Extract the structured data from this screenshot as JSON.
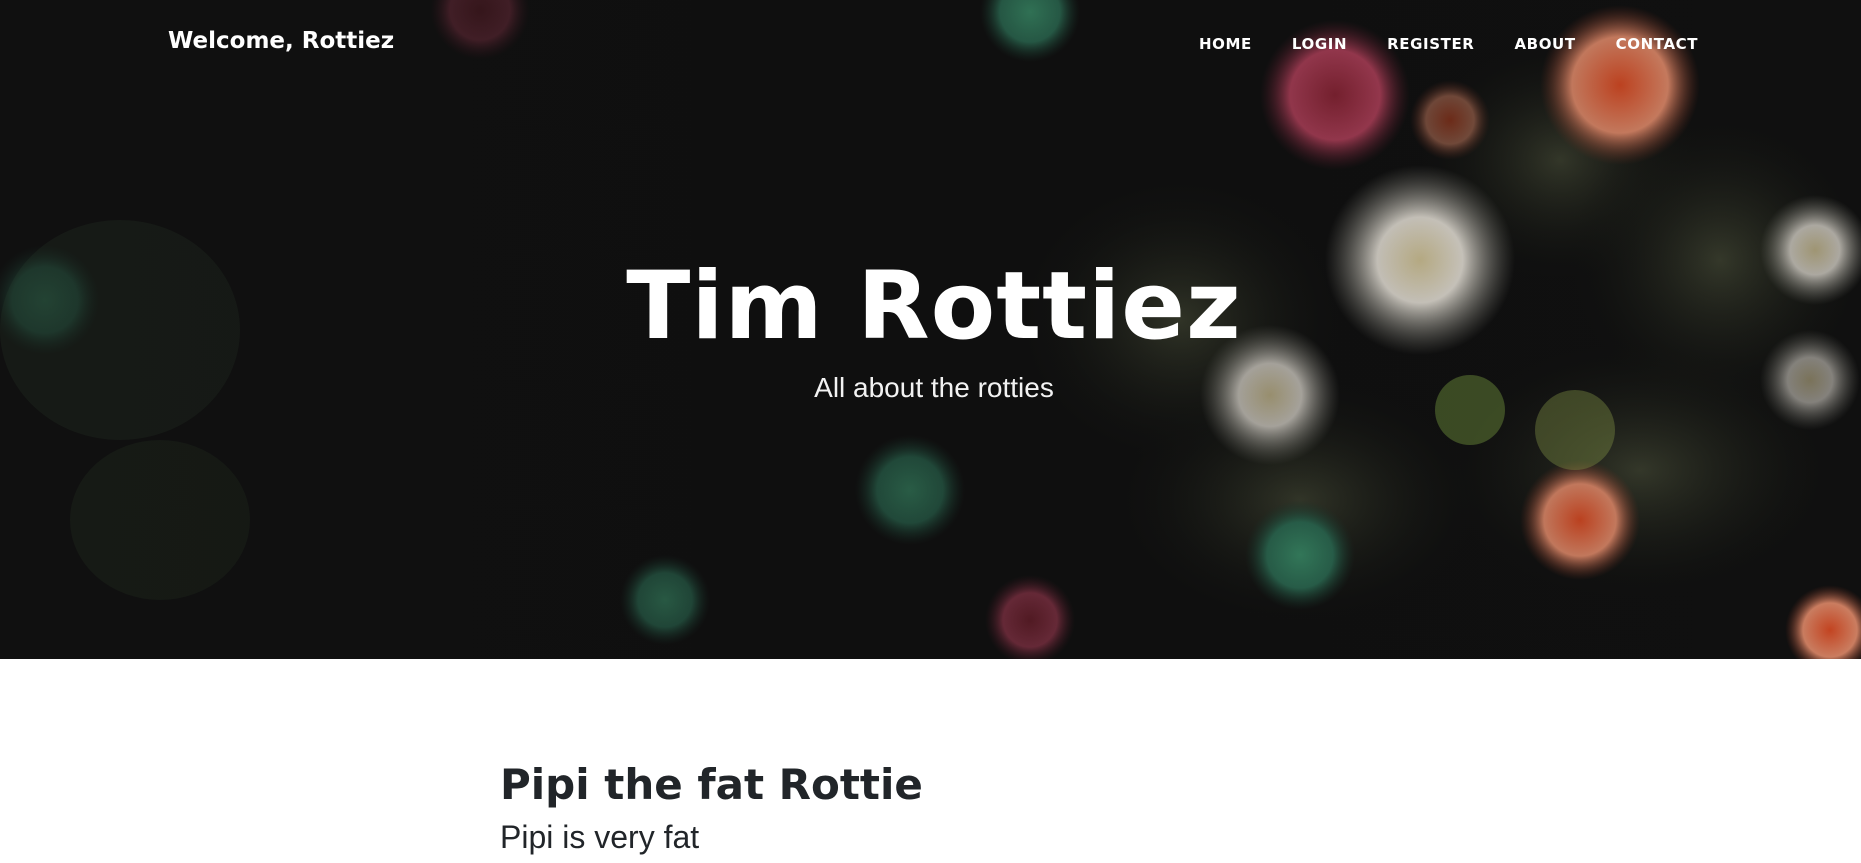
{
  "nav": {
    "brand": "Welcome, Rottiez",
    "links": [
      "HOME",
      "LOGIN",
      "REGISTER",
      "ABOUT",
      "CONTACT"
    ]
  },
  "hero": {
    "title": "Tim Rottiez",
    "subtitle": "All about the rotties"
  },
  "posts": [
    {
      "title": "Pipi the fat Rottie",
      "subtitle": "Pipi is very fat"
    }
  ],
  "colors": {
    "hero_overlay": "#0d0d0d",
    "text_light": "#ffffff",
    "text_dark": "#212529"
  }
}
